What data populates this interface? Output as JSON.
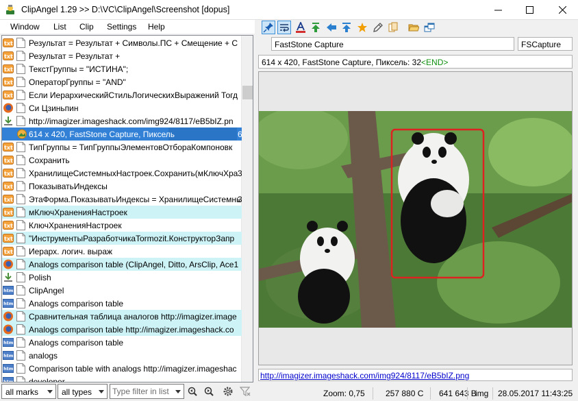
{
  "window": {
    "title": "ClipAngel 1.29 >> D:\\VC\\ClipAngel\\Screenshot [dopus]",
    "controls": [
      "minimize-icon",
      "maximize-icon",
      "close-icon"
    ]
  },
  "menu": [
    "Window",
    "List",
    "Clip",
    "Settings",
    "Help"
  ],
  "toolbar": {
    "icons": [
      "pin-icon",
      "word-wrap-icon",
      "text-format-icon",
      "move-top-icon",
      "back-arrow-icon",
      "upload-icon",
      "star-icon",
      "edit-pencil-icon",
      "copy-icon",
      "open-folder-icon",
      "windows-icon"
    ]
  },
  "list": {
    "items": [
      {
        "type": "txt",
        "text": "Результат = Результат + Символы.ПС + Смещение + С",
        "num": "",
        "hl": false,
        "sel": false
      },
      {
        "type": "txt",
        "text": "Результат = Результат +",
        "num": "",
        "hl": false,
        "sel": false
      },
      {
        "type": "txt",
        "text": "ТекстГруппы = \"ИСТИНА\";",
        "num": "",
        "hl": false,
        "sel": false
      },
      {
        "type": "txt",
        "text": "ОператорГруппы = \"AND\"",
        "num": "",
        "hl": false,
        "sel": false
      },
      {
        "type": "txt",
        "text": "Если ИерархическийСтильЛогическихВыражений Тогд",
        "num": "",
        "hl": false,
        "sel": false
      },
      {
        "type": "ff",
        "text": "Си Цзиньпин",
        "num": "",
        "hl": false,
        "sel": false
      },
      {
        "type": "dl",
        "text": "http://imagizer.imageshack.com/img924/8117/eB5bIZ.pn",
        "num": "",
        "hl": false,
        "sel": false
      },
      {
        "type": "img",
        "text": "614 x 420, FastStone Capture, Пиксель",
        "num": "6",
        "hl": false,
        "sel": true
      },
      {
        "type": "txt",
        "text": "ТипГруппы = ТипГруппыЭлементовОтбораКомпоновк",
        "num": "",
        "hl": false,
        "sel": false
      },
      {
        "type": "txt",
        "text": "Сохранить",
        "num": "",
        "hl": false,
        "sel": false
      },
      {
        "type": "txt",
        "text": "ХранилищеСистемныхНастроек.Сохранить(мКлючХра",
        "num": "3",
        "hl": false,
        "sel": false
      },
      {
        "type": "txt",
        "text": "ПоказыватьИндексы",
        "num": "",
        "hl": false,
        "sel": false
      },
      {
        "type": "txt",
        "text": "ЭтаФорма.ПоказыватьИндексы = ХранилищеСистемнь",
        "num": "3",
        "hl": false,
        "sel": false
      },
      {
        "type": "txt",
        "text": "мКлючХраненияНастроек",
        "num": "",
        "hl": true,
        "sel": false
      },
      {
        "type": "txt",
        "text": "КлючХраненияНастроек",
        "num": "",
        "hl": false,
        "sel": false
      },
      {
        "type": "txt",
        "text": "\"ИнструментыРазработчикаTormozit.КонструкторЗапр",
        "num": "",
        "hl": true,
        "sel": false
      },
      {
        "type": "txt",
        "text": "Иерарх. логич. выраж",
        "num": "",
        "hl": false,
        "sel": false
      },
      {
        "type": "ff",
        "text": "Analogs comparison table (ClipAngel, Ditto, ArsClip, Ace1",
        "num": "",
        "hl": true,
        "sel": false
      },
      {
        "type": "dl",
        "text": "Polish",
        "num": "",
        "hl": false,
        "sel": false
      },
      {
        "type": "html",
        "text": "ClipAngel",
        "num": "",
        "hl": false,
        "sel": false
      },
      {
        "type": "html",
        "text": "Analogs comparison table",
        "num": "",
        "hl": false,
        "sel": false
      },
      {
        "type": "ff",
        "text": "Сравнительная таблица аналогов http://imagizer.image",
        "num": "",
        "hl": true,
        "sel": false
      },
      {
        "type": "ff",
        "text": "Analogs comparison table http://imagizer.imageshack.co",
        "num": "",
        "hl": true,
        "sel": false
      },
      {
        "type": "html",
        "text": "Analogs comparison table",
        "num": "",
        "hl": false,
        "sel": false
      },
      {
        "type": "html",
        "text": "analogs",
        "num": "",
        "hl": false,
        "sel": false
      },
      {
        "type": "html",
        "text": "Comparison table with analogs http://imagizer.imageshac",
        "num": "",
        "hl": false,
        "sel": false
      },
      {
        "type": "html",
        "text": "developer",
        "num": "",
        "hl": false,
        "sel": false
      }
    ]
  },
  "filters": {
    "marks": "all marks",
    "types": "all types",
    "search_placeholder": "Type filter in list"
  },
  "bottom_icons": [
    "find-prev-icon",
    "find-next-icon",
    "settings-gear-icon",
    "clear-filter-icon"
  ],
  "detail": {
    "window_title": "FastStone Capture",
    "process": "FSCapture",
    "summary_prefix": "614 x 420, FastStone Capture, Пиксель: 32",
    "summary_end": "<END>",
    "url": "http://imagizer.imageshack.com/img924/8117/eB5bIZ.png"
  },
  "status": {
    "zoom": "Zoom: 0,75",
    "chars": "257 880 C",
    "size": "641 643 B",
    "type": "img",
    "datetime": "28.05.2017 11:43:25"
  },
  "colors": {
    "selection": "#3281d6",
    "highlight": "#cdf3f7",
    "link": "#0000cc",
    "end_marker": "#0f8f0f"
  }
}
